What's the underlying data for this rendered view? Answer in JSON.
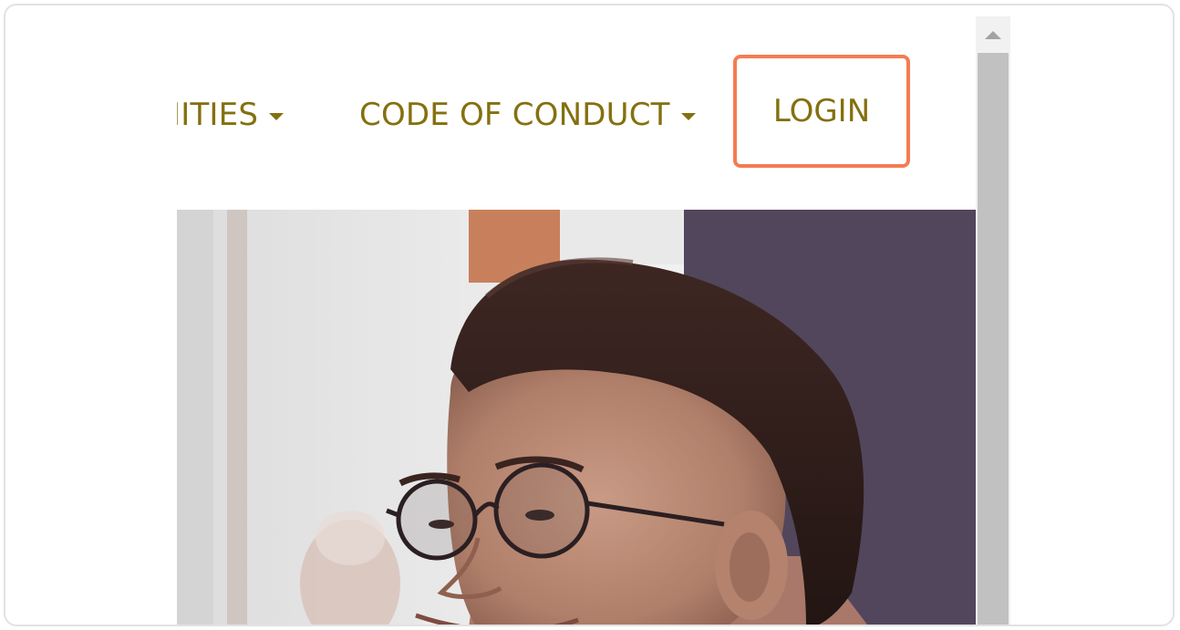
{
  "nav": {
    "items": [
      {
        "label": "IITIES",
        "has_dropdown": true
      },
      {
        "label": "CODE OF CONDUCT",
        "has_dropdown": true
      }
    ],
    "login_label": "LOGIN"
  },
  "colors": {
    "nav_text": "#84700f",
    "login_highlight": "#f47c52",
    "scrollbar_thumb": "#c1c1c1",
    "scrollbar_track": "#f1f1f1"
  },
  "icons": {
    "dropdown": "caret-down-icon",
    "scroll_up": "triangle-up-icon"
  }
}
